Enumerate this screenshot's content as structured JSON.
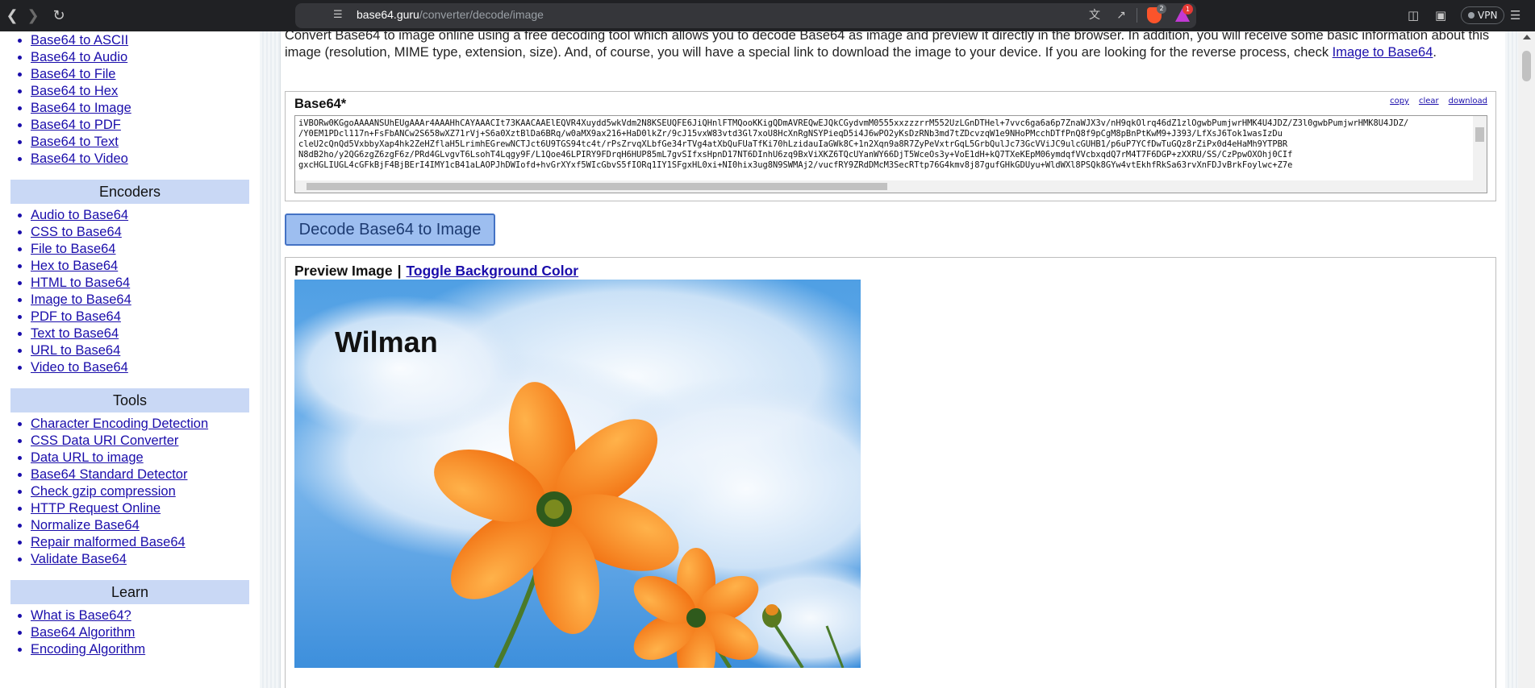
{
  "browser": {
    "url_host": "base64.guru",
    "url_path": "/converter/decode/image",
    "shield_count": "2",
    "rewards_count": "1",
    "vpn_label": "VPN"
  },
  "sidebar": {
    "decoders_items": [
      {
        "label": "Base64 to ASCII"
      },
      {
        "label": "Base64 to Audio"
      },
      {
        "label": "Base64 to File"
      },
      {
        "label": "Base64 to Hex"
      },
      {
        "label": "Base64 to Image"
      },
      {
        "label": "Base64 to PDF"
      },
      {
        "label": "Base64 to Text"
      },
      {
        "label": "Base64 to Video"
      }
    ],
    "encoders_title": "Encoders",
    "encoders_items": [
      {
        "label": "Audio to Base64"
      },
      {
        "label": "CSS to Base64"
      },
      {
        "label": "File to Base64"
      },
      {
        "label": "Hex to Base64"
      },
      {
        "label": "HTML to Base64"
      },
      {
        "label": "Image to Base64"
      },
      {
        "label": "PDF to Base64"
      },
      {
        "label": "Text to Base64"
      },
      {
        "label": "URL to Base64"
      },
      {
        "label": "Video to Base64"
      }
    ],
    "tools_title": "Tools",
    "tools_items": [
      {
        "label": "Character Encoding Detection"
      },
      {
        "label": "CSS Data URI Converter"
      },
      {
        "label": "Data URL to image"
      },
      {
        "label": "Base64 Standard Detector"
      },
      {
        "label": "Check gzip compression"
      },
      {
        "label": "HTTP Request Online"
      },
      {
        "label": "Normalize Base64"
      },
      {
        "label": "Repair malformed Base64"
      },
      {
        "label": "Validate Base64"
      }
    ],
    "learn_title": "Learn",
    "learn_items": [
      {
        "label": "What is Base64?"
      },
      {
        "label": "Base64 Algorithm"
      },
      {
        "label": "Encoding Algorithm"
      }
    ]
  },
  "main": {
    "intro_text": "Convert Base64 to image online using a free decoding tool which allows you to decode Base64 as image and preview it directly in the browser. In addition, you will receive some basic information about this image (resolution, MIME type, extension, size). And, of course, you will have a special link to download the image to your device. If you are looking for the reverse process, check ",
    "intro_link": "Image to Base64",
    "intro_end": ".",
    "base64_label": "Base64*",
    "actions": {
      "copy": "copy",
      "clear": "clear",
      "download": "download"
    },
    "base64_lines": [
      "iVBORw0KGgoAAAANSUhEUgAAAr4AAAHhCAYAAACIt73KAACAAElEQVR4Xuydd5wkVdm2N8KSEUQFE6JiQHnlFTMQooKKigQDmAVREQwEJQkCGydvmM0555xxzzzrrM552UzLGnDTHel+7vvc6ga6a6p7ZnaWJX3v/nH9qkOlrq46dZ1zlOgwbPumjwrHMK4U4JDZ/Z3l0gwbPumjwrHMK8U4JDZ/",
      "/Y0EM1PDcl117n+FsFbANCw2S658wXZ71rVj+S6a0XztBlDa6BRq/w0aMX9ax216+HaD0lkZr/9cJ15vxW83vtd3Gl7xoU8HcXnRgNSYPieqD5i4J6wPO2yKsDzRNb3md7tZDcvzqW1e9NHoPMcchDTfPnQ8f9pCgM8pBnPtKwM9+J393/LfXsJ6Tok1wasIzDu",
      "cleU2cQnQd5VxbbyXap4hk2ZeHZflaH5LrimhEGrewNCTJct6U9TGS94tc4t/rPsZrvqXLbfGe34rTVg4atXbQuFUaTfKi70hLzidauIaGWk8C+1n2Xqn9a8R7ZyPeVxtrGqL5GrbQulJc73GcVViJC9ulcGUHB1/p6uP7YCfDwTuGQz8rZiPx0d4eHaMh9YTPBR",
      "N8dB2ho/y2QG6zgZ6zgF6z/PRd4GLvgvT6LsohT4Lqgy9F/L1Qoe46LPIRY9FDrqH6HUP85mL7gvSIfxsHpnD17NT6DInhU6zq9BxViXKZ6TQcUYanWY66DjT5WceOs3y+VoE1dH+kQ7TXeKEpM06ymdqfVVcbxqdQ7rM4T7F6DGP+zXXRU/SS/CzPpwOXOhj0CIf",
      "gxcHGLIUGL4cGFkBjF4BjBErI4IMY1cB41aLAOPJhDWIofd+hvGrXYxf5WIcGbvS5fIORq1IY1SFgxHL0xi+NI0hix3ug8N9SWMAj2/vucfRY9ZRdDMcM3SecRTtp76G4kmv8j87gufGHkGDUyu+WldWXl8PSQk8GYw4vtEkhfRkSa63rvXnFDJvBrkFoylwc+Z7e"
    ],
    "decode_button": "Decode Base64 to Image",
    "preview_label": "Preview Image",
    "preview_sep": "|",
    "toggle_bg": "Toggle Background Color",
    "preview_watermark": "Wilman",
    "colors": {
      "link": "#1a0dab",
      "sidebar_header_bg": "#c9d8f5",
      "button_bg": "#9dbef0",
      "button_border": "#4472c4"
    }
  }
}
